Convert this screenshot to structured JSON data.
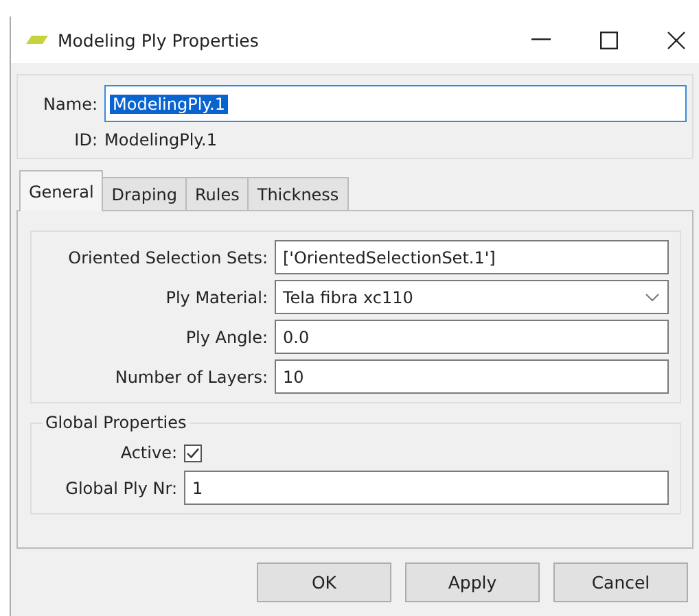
{
  "window": {
    "title": "Modeling Ply Properties"
  },
  "name": {
    "label": "Name:",
    "value": "ModelingPly.1",
    "selected": true
  },
  "id": {
    "label": "ID:",
    "value": "ModelingPly.1"
  },
  "tabs": [
    {
      "label": "General",
      "selected": true
    },
    {
      "label": "Draping",
      "selected": false
    },
    {
      "label": "Rules",
      "selected": false
    },
    {
      "label": "Thickness",
      "selected": false
    }
  ],
  "fields": [
    {
      "label": "Oriented Selection Sets:",
      "value": "['OrientedSelectionSet.1']",
      "kind": "text"
    },
    {
      "label": "Ply Material:",
      "value": "Tela fibra xc110",
      "kind": "dropdown"
    },
    {
      "label": "Ply Angle:",
      "value": "0.0",
      "kind": "text"
    },
    {
      "label": "Number of Layers:",
      "value": "10",
      "kind": "text"
    }
  ],
  "global_properties": {
    "title": "Global Properties",
    "active": {
      "label": "Active:",
      "checked": true
    },
    "ply_nr": {
      "label": "Global Ply Nr:",
      "value": "1"
    }
  },
  "buttons": [
    "OK",
    "Apply",
    "Cancel"
  ]
}
